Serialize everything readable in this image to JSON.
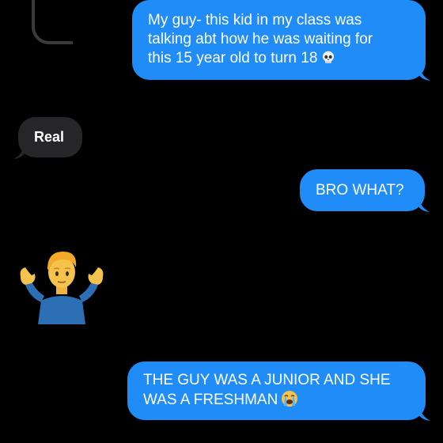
{
  "conversation": {
    "messages": [
      {
        "direction": "sent",
        "text": "My guy- this kid in my class was\ntalking abt how he was waiting for\nthis 15 year old to turn 18",
        "emoji": "skull"
      },
      {
        "direction": "received",
        "text": "Real"
      },
      {
        "direction": "sent",
        "text": "BRO WHAT?"
      },
      {
        "direction": "received",
        "emoji": "man-shrugging"
      },
      {
        "direction": "sent",
        "text": "THE GUY WAS A JUNIOR AND SHE\nWAS A FRESHMAN",
        "emoji": "loudly-crying-face"
      }
    ]
  },
  "colors": {
    "background": "#000000",
    "sent_bubble": "#1f8cf8",
    "received_bubble": "#262629",
    "text": "#ffffff"
  }
}
